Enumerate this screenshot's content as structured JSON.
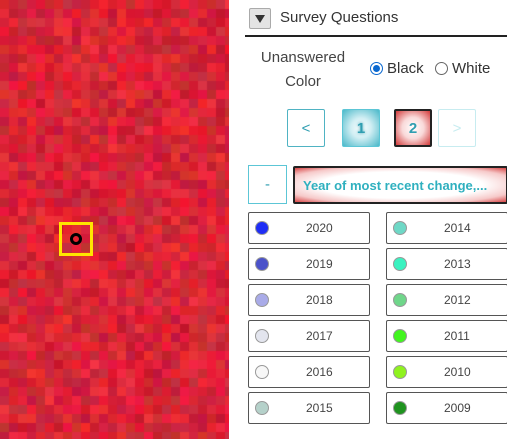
{
  "map": {
    "base_color": "#cf1f33",
    "marker_color": "#ffe600"
  },
  "header": {
    "title": "Survey Questions"
  },
  "unanswered": {
    "label_line1": "Unanswered",
    "label_line2": "Color",
    "options": [
      {
        "label": "Black",
        "checked": true
      },
      {
        "label": "White",
        "checked": false
      }
    ]
  },
  "pagination": {
    "prev_label": "<",
    "pages": [
      "1",
      "2"
    ],
    "current_page": "2",
    "next_label": ">"
  },
  "question": {
    "collapse_label": "-",
    "title": "Year of most recent change,..."
  },
  "legend": {
    "left": [
      {
        "year": "2020",
        "color": "#1f2ef5"
      },
      {
        "year": "2019",
        "color": "#4b52c9"
      },
      {
        "year": "2018",
        "color": "#a9abe8"
      },
      {
        "year": "2017",
        "color": "#e3e5ee"
      },
      {
        "year": "2016",
        "color": "#f7f7f7"
      },
      {
        "year": "2015",
        "color": "#b5d1ca"
      }
    ],
    "right": [
      {
        "year": "2014",
        "color": "#6ed8c6"
      },
      {
        "year": "2013",
        "color": "#3af2c0"
      },
      {
        "year": "2012",
        "color": "#6fd68a"
      },
      {
        "year": "2011",
        "color": "#42f51f"
      },
      {
        "year": "2010",
        "color": "#8ff21f"
      },
      {
        "year": "2009",
        "color": "#1f931f"
      }
    ]
  }
}
